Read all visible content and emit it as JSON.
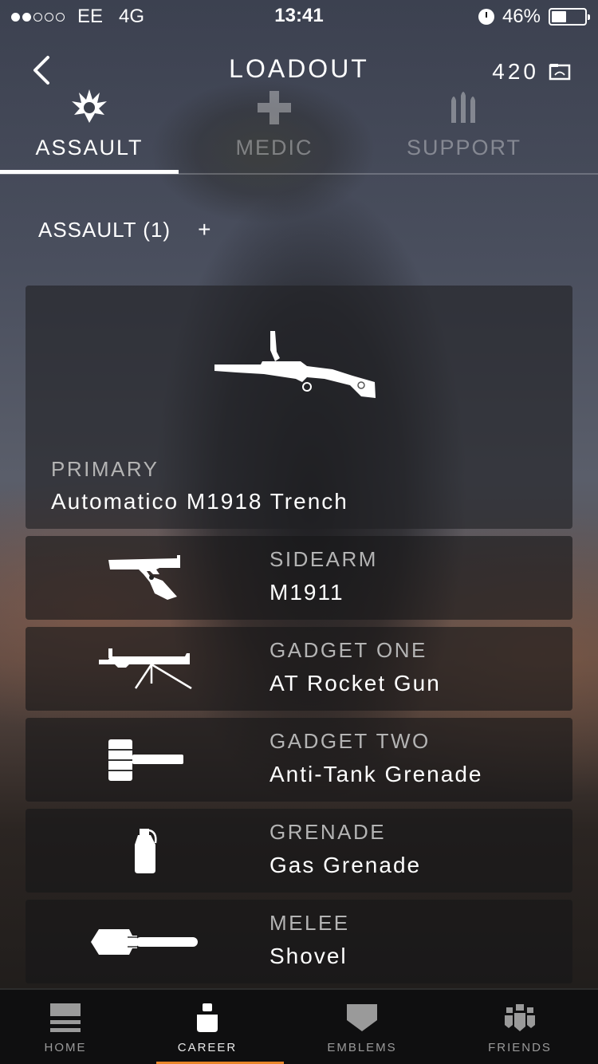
{
  "status_bar": {
    "carrier": "EE",
    "network": "4G",
    "time": "13:41",
    "battery": "46%",
    "battery_level": 0.46,
    "signal_bars": 2
  },
  "header": {
    "title": "LOADOUT",
    "currency_amount": "420",
    "back_icon": "chevron-left-icon",
    "currency_icon": "warbond-icon"
  },
  "tabs": [
    {
      "label": "ASSAULT",
      "icon": "explosion-icon",
      "active": true
    },
    {
      "label": "MEDIC",
      "icon": "cross-icon",
      "active": false
    },
    {
      "label": "SUPPORT",
      "icon": "ammo-icon",
      "active": false
    }
  ],
  "loadout": {
    "name": "ASSAULT (1)",
    "add_label": "+"
  },
  "primary": {
    "slot": "PRIMARY",
    "weapon": "Automatico M1918 Trench",
    "icon": "smg-icon"
  },
  "items": [
    {
      "slot": "SIDEARM",
      "weapon": "M1911",
      "icon": "pistol-icon"
    },
    {
      "slot": "GADGET ONE",
      "weapon": "AT Rocket Gun",
      "icon": "rocket-gun-icon"
    },
    {
      "slot": "GADGET TWO",
      "weapon": "Anti-Tank Grenade",
      "icon": "anti-tank-grenade-icon"
    },
    {
      "slot": "GRENADE",
      "weapon": "Gas Grenade",
      "icon": "gas-grenade-icon"
    },
    {
      "slot": "MELEE",
      "weapon": "Shovel",
      "icon": "shovel-icon"
    }
  ],
  "bottom_nav": [
    {
      "label": "HOME",
      "icon": "home-icon",
      "active": false
    },
    {
      "label": "CAREER",
      "icon": "soldier-icon",
      "active": true
    },
    {
      "label": "EMBLEMS",
      "icon": "emblem-icon",
      "active": false
    },
    {
      "label": "FRIENDS",
      "icon": "friends-icon",
      "active": false
    }
  ],
  "colors": {
    "active_nav_accent": "#e8862a"
  }
}
